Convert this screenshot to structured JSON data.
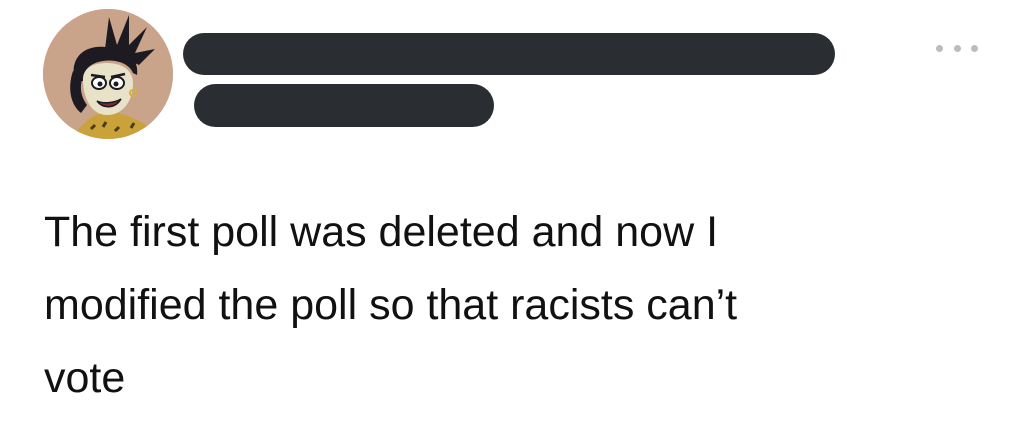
{
  "tweet": {
    "text": "The first poll was deleted and now I\nmodified the poll so that racists can’t\nvote",
    "author": {
      "avatar_icon": "cartoon-character-avatar",
      "name_redacted": true,
      "handle_redacted": true
    },
    "more_icon": "more-options-icon"
  },
  "colors": {
    "background": "#ffffff",
    "text": "#111111",
    "redaction": "#2a2d31",
    "more_dots": "#b8bdc2",
    "avatar_bg": "#caa48a"
  }
}
